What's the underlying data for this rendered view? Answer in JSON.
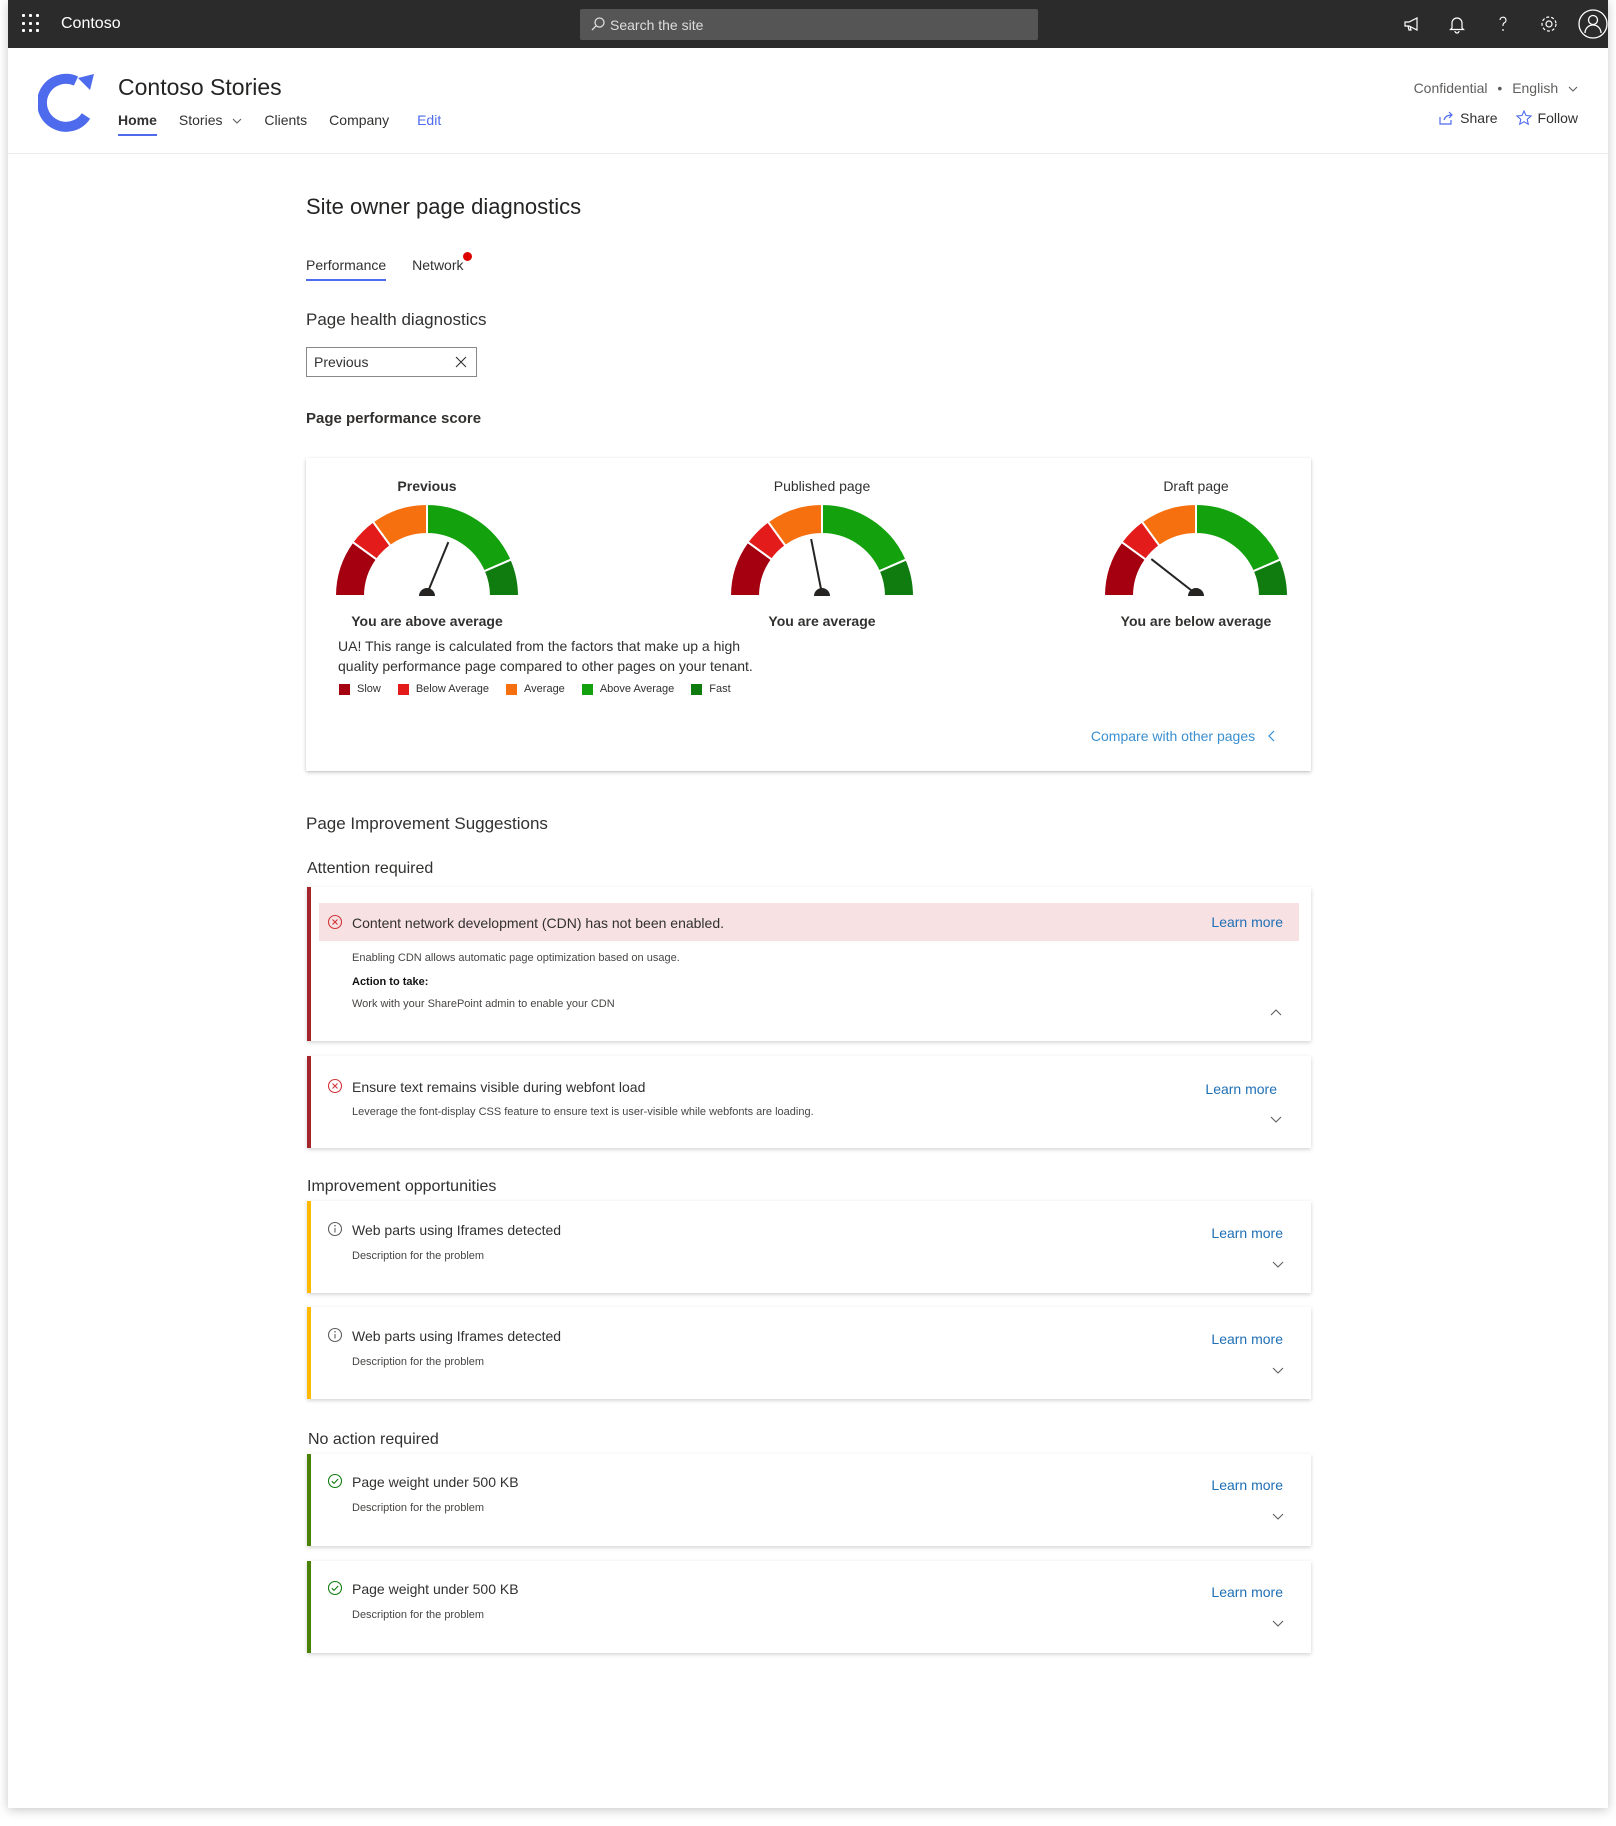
{
  "suite": {
    "brand": "Contoso",
    "search_placeholder": "Search the site"
  },
  "header": {
    "site_title": "Contoso Stories",
    "nav": [
      "Home",
      "Stories",
      "Clients",
      "Company",
      "Edit"
    ],
    "classification": "Confidential",
    "separator": "•",
    "language": "English",
    "share": "Share",
    "follow": "Follow"
  },
  "page": {
    "title": "Site owner page diagnostics",
    "tabs": [
      "Performance",
      "Network"
    ],
    "health_heading": "Page health diagnostics",
    "filter_value": "Previous",
    "score_heading": "Page performance score"
  },
  "score_card": {
    "gauges": [
      {
        "title": "Previous",
        "status": "You are above average",
        "needle_fraction": 0.62
      },
      {
        "title": "Published page",
        "status": "You are average",
        "needle_fraction": 0.44
      },
      {
        "title": "Draft page",
        "status": "You are below  average",
        "needle_fraction": 0.22
      }
    ],
    "note": "UA! This range is calculated from the factors that make up a high quality performance page compared to other pages on your tenant.",
    "legend": [
      {
        "label": "Slow",
        "color": "#a4000f"
      },
      {
        "label": "Below Average",
        "color": "#e31b1b"
      },
      {
        "label": "Average",
        "color": "#f7700f"
      },
      {
        "label": "Above Average",
        "color": "#13a10e"
      },
      {
        "label": "Fast",
        "color": "#107c10"
      }
    ],
    "compare_link": "Compare with other pages"
  },
  "suggestions": {
    "heading": "Page Improvement Suggestions",
    "attention_heading": "Attention required",
    "opportunities_heading": "Improvement opportunities",
    "no_action_heading": "No action required",
    "learn_more": "Learn more",
    "attention": [
      {
        "title": "Content network development (CDN) has not been enabled.",
        "description": "Enabling CDN allows automatic page optimization based on usage.",
        "action_label": "Action to take:",
        "action": "Work with your SharePoint admin to enable your CDN"
      },
      {
        "title": "Ensure text remains visible during webfont load",
        "description": "Leverage the font-display CSS feature to ensure text is user-visible while webfonts are loading."
      }
    ],
    "opportunities": [
      {
        "title": "Web parts using Iframes detected",
        "description": "Description for the problem"
      },
      {
        "title": "Web parts using Iframes detected",
        "description": "Description for the problem"
      }
    ],
    "no_action": [
      {
        "title": "Page weight under 500 KB",
        "description": "Description for the problem"
      },
      {
        "title": "Page weight under 500 KB",
        "description": "Description for the problem"
      }
    ]
  },
  "colors": {
    "accent": "#4f6bed",
    "error": "#a4262c",
    "warning": "#ffb900",
    "success": "#498205"
  }
}
